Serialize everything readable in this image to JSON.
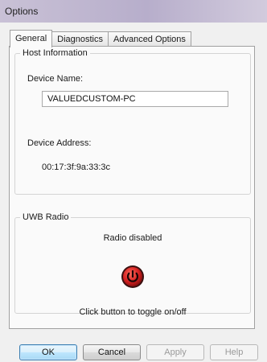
{
  "window": {
    "title": "Options"
  },
  "tabs": [
    {
      "label": "General",
      "active": true
    },
    {
      "label": "Diagnostics",
      "active": false
    },
    {
      "label": "Advanced Options",
      "active": false
    }
  ],
  "host_info": {
    "legend": "Host Information",
    "device_name_label": "Device Name:",
    "device_name_value": "VALUEDCUSTOM-PC",
    "device_address_label": "Device Address:",
    "device_address_value": "00:17:3f:9a:33:3c"
  },
  "uwb_radio": {
    "legend": "UWB Radio",
    "status": "Radio disabled",
    "toggle_icon": "power-icon",
    "toggle_color": "#d42020",
    "hint": "Click button to toggle on/off"
  },
  "buttons": {
    "ok": "OK",
    "cancel": "Cancel",
    "apply": "Apply",
    "help": "Help"
  }
}
